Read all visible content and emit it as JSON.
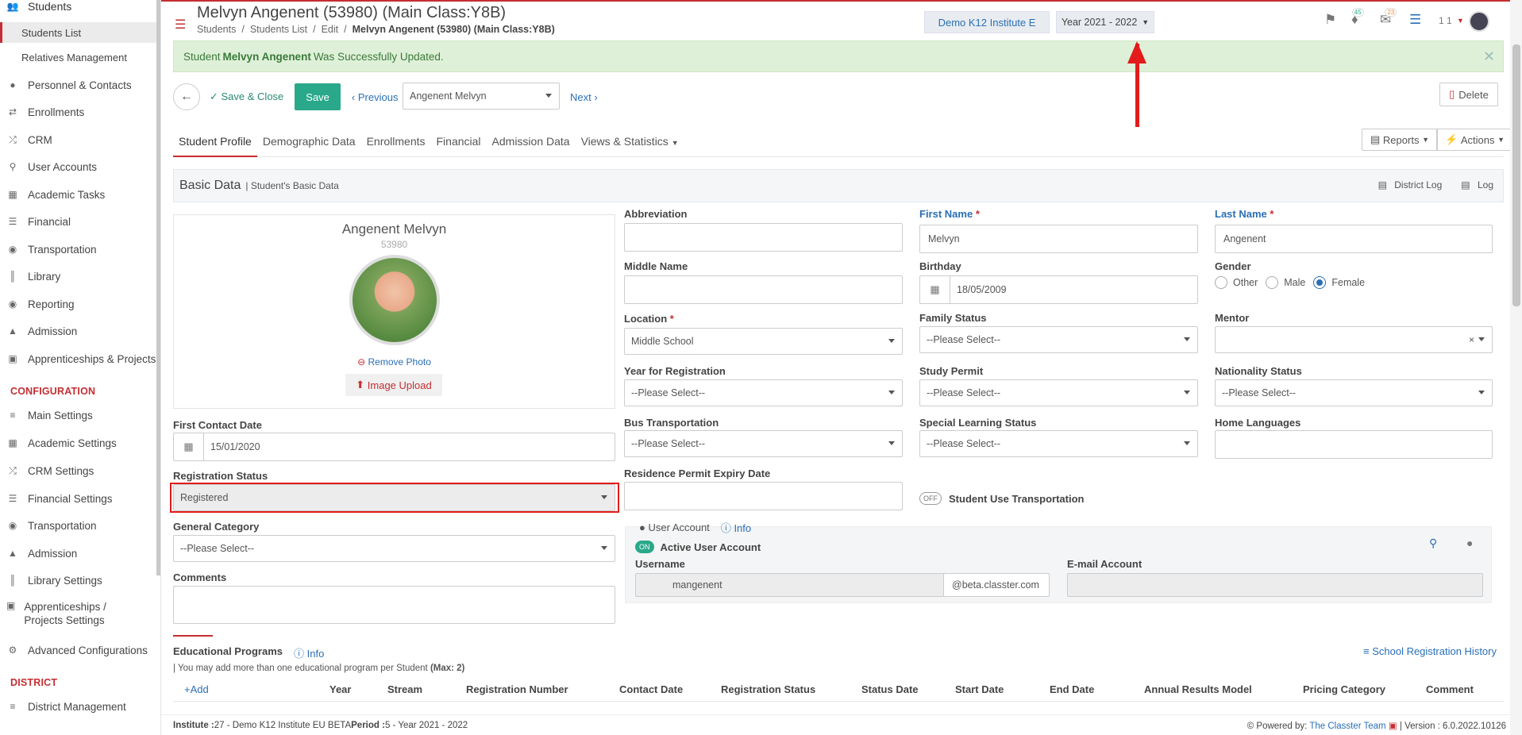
{
  "sidebar": {
    "items": [
      {
        "label": "Students",
        "icon": "users-icon"
      },
      {
        "label": "Students List",
        "icon": ""
      },
      {
        "label": "Relatives Management",
        "icon": ""
      },
      {
        "label": "Personnel & Contacts",
        "icon": "person-icon"
      },
      {
        "label": "Enrollments",
        "icon": "exchange-icon"
      },
      {
        "label": "CRM",
        "icon": "shuffle-icon"
      },
      {
        "label": "User Accounts",
        "icon": "key-icon"
      },
      {
        "label": "Academic Tasks",
        "icon": "grid-icon"
      },
      {
        "label": "Financial",
        "icon": "coins-icon"
      },
      {
        "label": "Transportation",
        "icon": "bus-icon"
      },
      {
        "label": "Library",
        "icon": "books-icon"
      },
      {
        "label": "Reporting",
        "icon": "report-icon"
      },
      {
        "label": "Admission",
        "icon": "institution-icon"
      },
      {
        "label": "Apprenticeships & Projects",
        "icon": "cube-icon"
      }
    ],
    "config_title": "CONFIGURATION",
    "config_items": [
      {
        "label": "Main Settings",
        "icon": "sliders-icon"
      },
      {
        "label": "Academic Settings",
        "icon": "grid-icon"
      },
      {
        "label": "CRM Settings",
        "icon": "shuffle-icon"
      },
      {
        "label": "Financial Settings",
        "icon": "coins-icon"
      },
      {
        "label": "Transportation",
        "icon": "bus-icon"
      },
      {
        "label": "Admission",
        "icon": "institution-icon"
      },
      {
        "label": "Library Settings",
        "icon": "books-icon"
      },
      {
        "label": "Apprenticeships / Projects Settings",
        "icon": "cube-icon"
      },
      {
        "label": "Advanced Configurations",
        "icon": "gears-icon"
      }
    ],
    "district_title": "DISTRICT",
    "district_items": [
      {
        "label": "District Management",
        "icon": "list-icon"
      }
    ]
  },
  "header": {
    "title": "Melvyn Angenent (53980) (Main Class:Y8B)",
    "breadcrumb": [
      "Students",
      "/",
      "Students List",
      "/",
      "Edit",
      "/",
      "Melvyn Angenent (53980) (Main Class:Y8B)"
    ],
    "institute": "Demo K12 Institute E",
    "year": "Year 2021 - 2022",
    "notif_count": "45",
    "mail_count": "23",
    "user_short": "1 1"
  },
  "alert": {
    "prefix": "Student ",
    "name": "Melvyn Angenent",
    "suffix": " Was Successfully Updated."
  },
  "toolbar": {
    "save_close": "Save & Close",
    "save": "Save",
    "previous": "Previous",
    "student_select": "Angenent Melvyn",
    "next": "Next",
    "delete": "Delete"
  },
  "tabs": [
    "Student Profile",
    "Demographic Data",
    "Enrollments",
    "Financial",
    "Admission Data",
    "Views & Statistics"
  ],
  "reports_label": "Reports",
  "actions_label": "Actions",
  "basic": {
    "title": "Basic Data",
    "subtitle": "| Student's Basic Data",
    "district_log": "District Log",
    "log": "Log"
  },
  "photo": {
    "name": "Angenent Melvyn",
    "number": "53980",
    "remove": "Remove Photo",
    "upload": "Image Upload"
  },
  "form": {
    "abbreviation_label": "Abbreviation",
    "abbreviation_value": "",
    "first_name_label": "First Name",
    "first_name_value": "Melvyn",
    "last_name_label": "Last Name",
    "last_name_value": "Angenent",
    "middle_name_label": "Middle Name",
    "birthday_label": "Birthday",
    "birthday_value": "18/05/2009",
    "gender_label": "Gender",
    "gender_options": [
      "Other",
      "Male",
      "Female"
    ],
    "location_label": "Location",
    "location_value": "Middle School",
    "family_status_label": "Family Status",
    "mentor_label": "Mentor",
    "year_reg_label": "Year for Registration",
    "study_permit_label": "Study Permit",
    "nationality_label": "Nationality Status",
    "bus_label": "Bus Transportation",
    "special_label": "Special Learning Status",
    "home_lang_label": "Home Languages",
    "residence_label": "Residence Permit Expiry Date",
    "use_transport_label": "Student Use Transportation",
    "please_select": "--Please Select--",
    "first_contact_label": "First Contact Date",
    "first_contact_value": "15/01/2020",
    "reg_status_label": "Registration Status",
    "reg_status_value": "Registered",
    "general_cat_label": "General Category",
    "comments_label": "Comments",
    "toggle_off": "OFF",
    "toggle_on": "ON"
  },
  "user_account": {
    "title": "User Account",
    "info": "Info",
    "active_label": "Active User Account",
    "username_label": "Username",
    "username_value": "mangenent",
    "domain": "@beta.classter.com",
    "email_label": "E-mail Account"
  },
  "edu": {
    "title": "Educational Programs",
    "info": "Info",
    "note": "| You may add more than one educational program per Student",
    "note_max": "(Max: 2)",
    "history": "School Registration History",
    "add": "Add",
    "columns": [
      "Year",
      "Stream",
      "Registration Number",
      "Contact Date",
      "Registration Status",
      "Status Date",
      "Start Date",
      "End Date",
      "Annual Results Model",
      "Pricing Category",
      "Comment"
    ]
  },
  "footer": {
    "institute_label": "Institute :",
    "institute_value": " 27 - Demo K12 Institute EU BETA ",
    "period_label": "Period :",
    "period_value": " 5 - Year 2021 - 2022",
    "powered": "Powered by:",
    "team": "The Classter Team",
    "version": "| Version : 6.0.2022.10126"
  }
}
